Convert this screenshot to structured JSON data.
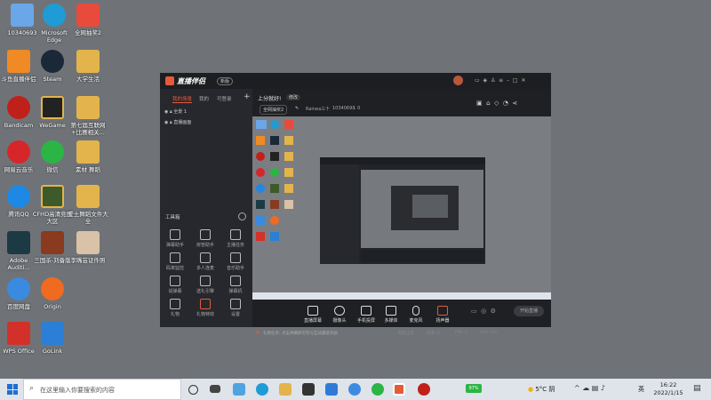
{
  "desktop": {
    "icons": [
      {
        "label": "10340693",
        "color": "#6aa6e8"
      },
      {
        "label": "Microsoft Edge",
        "color": "#1f9bd6"
      },
      {
        "label": "全网抽奖2",
        "color": "#e84a3c"
      },
      {
        "label": "斗鱼直播伴侣",
        "color": "#f08a24"
      },
      {
        "label": "Steam",
        "color": "#1b2838"
      },
      {
        "label": "大学生活",
        "color": "#e3b44b"
      },
      {
        "label": "Bandicam",
        "color": "#c0201a"
      },
      {
        "label": "WeGame",
        "color": "#222222"
      },
      {
        "label": "第七届互联网+比赛相关...",
        "color": "#e3b44b"
      },
      {
        "label": "网易云音乐",
        "color": "#d6262a"
      },
      {
        "label": "微信",
        "color": "#2bb545"
      },
      {
        "label": "素材 舞蹈",
        "color": "#e3b44b"
      },
      {
        "label": "腾讯QQ",
        "color": "#1e88e5"
      },
      {
        "label": "CFHD高清竞技大区",
        "color": "#3d5a2a"
      },
      {
        "label": "爱土舞蹈文件大全",
        "color": "#e3b44b"
      },
      {
        "label": "Adobe Auditi...",
        "color": "#1b3a44"
      },
      {
        "label": "三国杀-刘备版",
        "color": "#8a3a1e"
      },
      {
        "label": "李嘴芸证件照",
        "color": "#d9c2a8"
      },
      {
        "label": "百度网盘",
        "color": "#3a8ae0"
      },
      {
        "label": "Origin",
        "color": "#f06a20"
      },
      {
        "label": "WPS Office",
        "color": "#d3302a"
      },
      {
        "label": "GoLink",
        "color": "#2c7fd6"
      }
    ]
  },
  "app": {
    "logo": "直播伴侣",
    "badge": "新版",
    "tabs": [
      "我的场景",
      "我的",
      "可登录"
    ],
    "scene_items": [
      "全景 1",
      "直播画面"
    ],
    "title": "上分就好!",
    "edit": "修改",
    "category": "全网抽奖2",
    "user": "Rainea三十",
    "room_id": "10340693",
    "hot": "0",
    "toolbox": "工具箱",
    "tools": [
      "弹幕助手",
      "房管助手",
      "主播任务",
      "码率监控",
      "多人连麦",
      "音乐助手",
      "说弹幕",
      "送礼引擎",
      "弹幕机",
      "礼物",
      "礼物特效",
      "设置"
    ],
    "bottom_buttons": [
      "直播屏幕",
      "摄像头",
      "手机投屏",
      "多媒体",
      "麦克风",
      "扬声器"
    ],
    "start_button": "开始直播",
    "notice": "礼物任务: 点击弹幕即可参与互动赢取奖励",
    "status": [
      "网络正常",
      "码率: 0",
      "FPS: 0",
      "CPU: 0%"
    ]
  },
  "taskbar": {
    "search_placeholder": "在这里输入你要搜索的内容",
    "weather": "5°C 阴",
    "input_method": "英",
    "time": "16:22",
    "date": "2022/1/15",
    "battery": "97%"
  },
  "colors": {
    "desktop_bg": "#6f7377",
    "accent": "#e45b3a",
    "taskbar": "#dfe3ea"
  }
}
